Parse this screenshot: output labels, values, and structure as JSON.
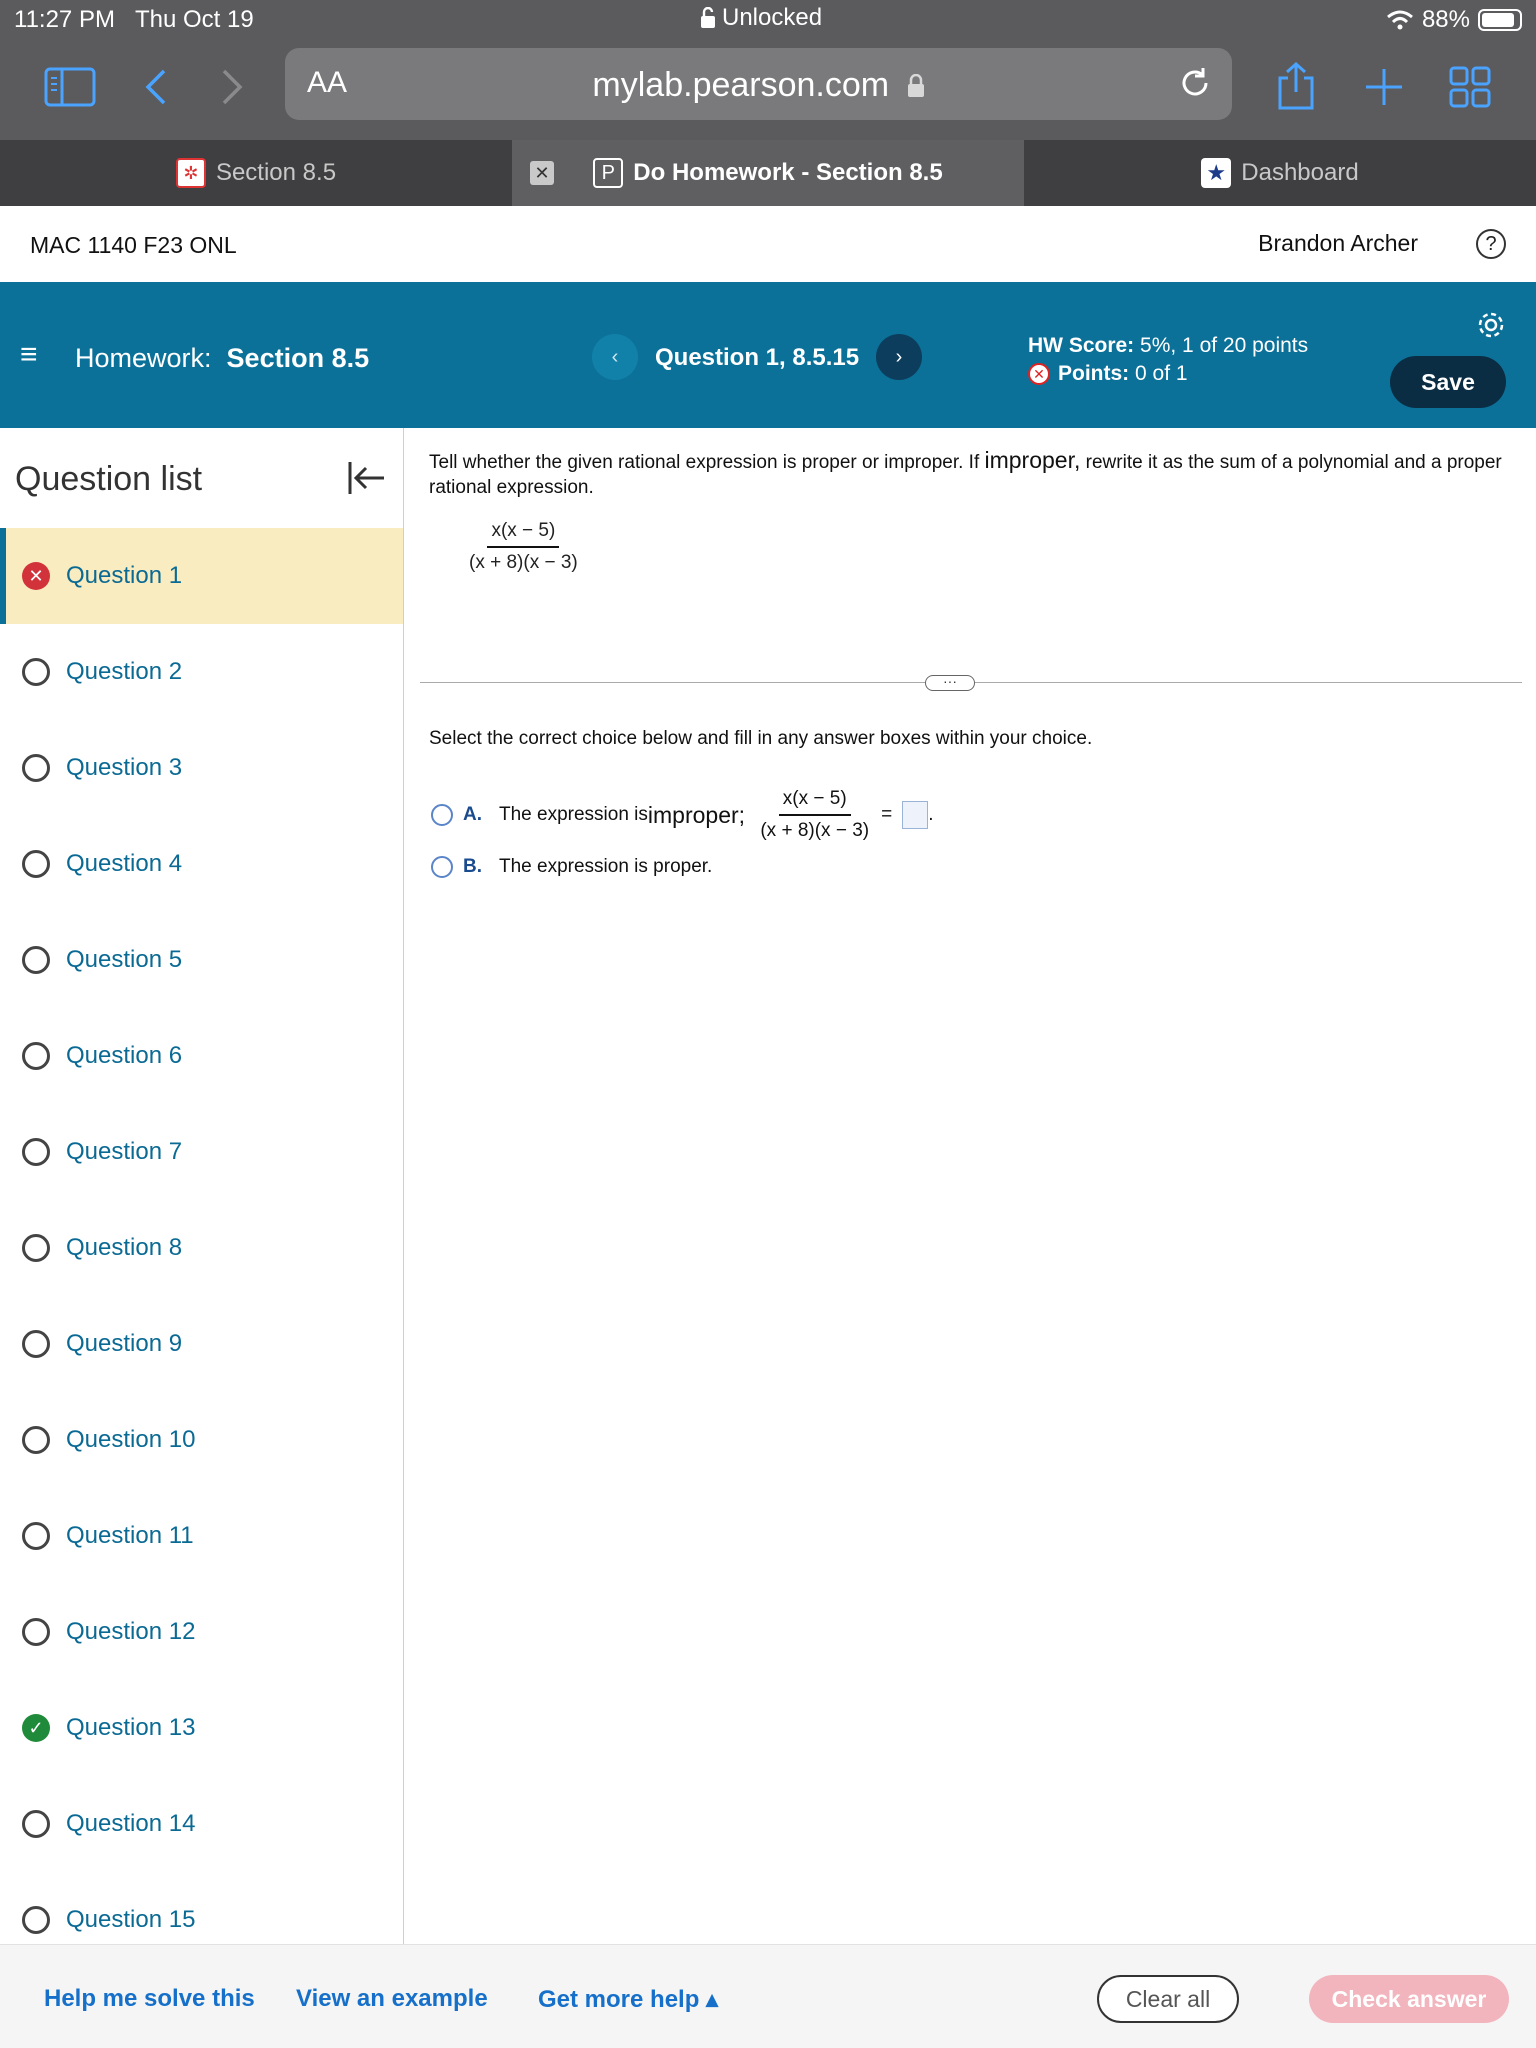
{
  "status_bar": {
    "time": "11:27 PM",
    "date": "Thu Oct 19",
    "lock_text": "Unlocked",
    "battery": "88%",
    "battery_level": 0.88
  },
  "browser": {
    "text_size": "AA",
    "url": "mylab.pearson.com"
  },
  "tabs": [
    {
      "label": "Section 8.5",
      "icon": "pearson-red-icon"
    },
    {
      "label": "Do Homework - Section 8.5",
      "icon": "p-icon",
      "active": true
    },
    {
      "label": "Dashboard",
      "icon": "star-icon"
    }
  ],
  "course": {
    "name": "MAC 1140 F23 ONL",
    "user": "Brandon Archer",
    "help_glyph": "?"
  },
  "homework": {
    "prefix": "Homework:",
    "title": "Section 8.5",
    "question_title": "Question 1, 8.5.15",
    "hw_score_label": "HW Score:",
    "hw_score_value": "5%, 1 of 20 points",
    "points_label": "Points:",
    "points_value": "0 of 1",
    "save_label": "Save"
  },
  "sidebar": {
    "title": "Question list",
    "items": [
      {
        "label": "Question 1",
        "status": "incorrect"
      },
      {
        "label": "Question 2",
        "status": "unanswered"
      },
      {
        "label": "Question 3",
        "status": "unanswered"
      },
      {
        "label": "Question 4",
        "status": "unanswered"
      },
      {
        "label": "Question 5",
        "status": "unanswered"
      },
      {
        "label": "Question 6",
        "status": "unanswered"
      },
      {
        "label": "Question 7",
        "status": "unanswered"
      },
      {
        "label": "Question 8",
        "status": "unanswered"
      },
      {
        "label": "Question 9",
        "status": "unanswered"
      },
      {
        "label": "Question 10",
        "status": "unanswered"
      },
      {
        "label": "Question 11",
        "status": "unanswered"
      },
      {
        "label": "Question 12",
        "status": "unanswered"
      },
      {
        "label": "Question 13",
        "status": "correct"
      },
      {
        "label": "Question 14",
        "status": "unanswered"
      },
      {
        "label": "Question 15",
        "status": "unanswered"
      }
    ]
  },
  "question": {
    "prompt_1": "Tell whether the given rational expression is proper or improper. If ",
    "prompt_big": "improper,",
    "prompt_2": " rewrite it as the sum of a polynomial and a proper rational expression.",
    "numerator": "x(x − 5)",
    "denominator": "(x + 8)(x − 3)",
    "instruction": "Select the correct choice below and fill in any answer boxes within your choice.",
    "choice_a_letter": "A.",
    "choice_a_text": "The expression is ",
    "choice_a_big": "improper;",
    "equals": "=",
    "period": ".",
    "choice_b_letter": "B.",
    "choice_b_text": "The expression is proper."
  },
  "footer": {
    "help_solve": "Help me solve this",
    "view_example": "View an example",
    "more_help": "Get more help ▴",
    "clear_all": "Clear all",
    "check_answer": "Check answer"
  },
  "colors": {
    "accent": "#0b7199",
    "link": "#1670c9",
    "incorrect": "#d2333a",
    "correct": "#1f8a3a",
    "active_question_bg": "#f8ecc0"
  }
}
